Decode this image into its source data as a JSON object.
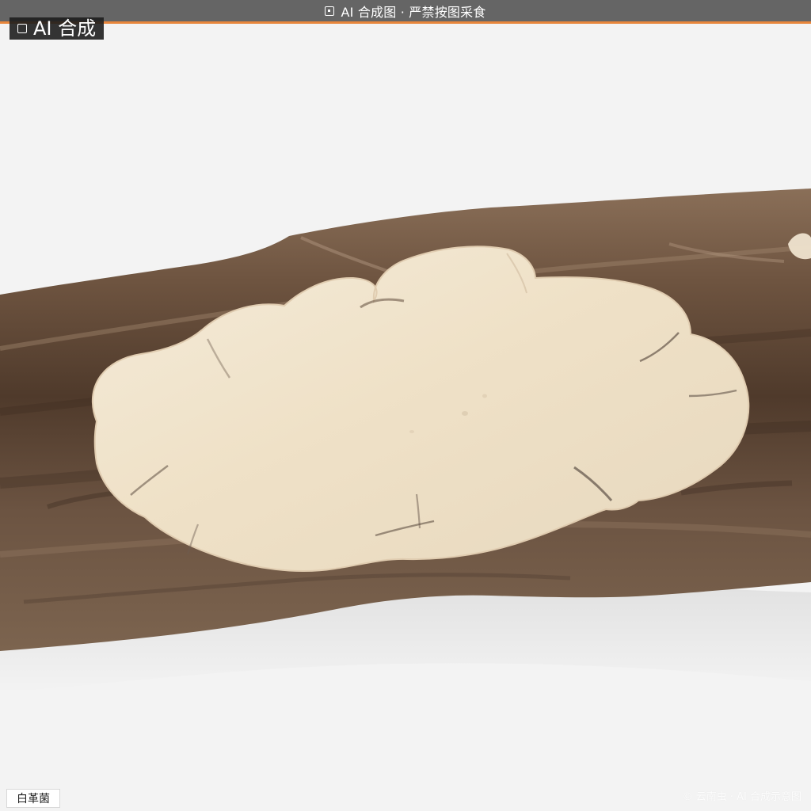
{
  "header": {
    "banner_text": "AI 合成图 · 严禁按图采食",
    "badge_text": "AI 合成"
  },
  "labels": {
    "species_name": "白革菌",
    "watermark_text": "© 云南虫 · AI 合成示意图"
  },
  "icons": {
    "banner_icon": "image-icon",
    "badge_icon": "image-icon"
  },
  "colors": {
    "banner_bg": "#5f5f5f",
    "banner_accent": "#e8863b",
    "badge_bg": "#1e1e1e"
  }
}
